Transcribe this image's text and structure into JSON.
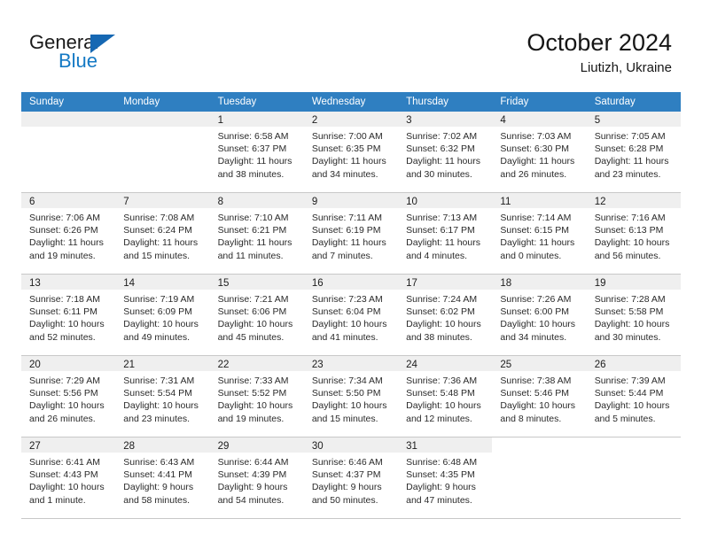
{
  "brand": {
    "name_top": "General",
    "name_bottom": "Blue",
    "triangle_color": "#1668b3",
    "blue_text_color": "#1479c4"
  },
  "header": {
    "title": "October 2024",
    "subtitle": "Liutizh, Ukraine"
  },
  "theme": {
    "header_row_bg": "#2f7fc1",
    "header_row_text": "#ffffff",
    "daynum_bar_bg": "#efefef",
    "grid_line": "#c8c8c8",
    "body_text": "#2a2a2a"
  },
  "labels": {
    "sunrise_prefix": "Sunrise:",
    "sunset_prefix": "Sunset:",
    "daylight_prefix": "Daylight:"
  },
  "weekdays": [
    "Sunday",
    "Monday",
    "Tuesday",
    "Wednesday",
    "Thursday",
    "Friday",
    "Saturday"
  ],
  "weeks": [
    [
      {
        "day": "",
        "empty": true,
        "lines": []
      },
      {
        "day": "",
        "empty": true,
        "lines": []
      },
      {
        "day": "1",
        "lines": [
          "Sunrise: 6:58 AM",
          "Sunset: 6:37 PM",
          "Daylight: 11 hours",
          "and 38 minutes."
        ]
      },
      {
        "day": "2",
        "lines": [
          "Sunrise: 7:00 AM",
          "Sunset: 6:35 PM",
          "Daylight: 11 hours",
          "and 34 minutes."
        ]
      },
      {
        "day": "3",
        "lines": [
          "Sunrise: 7:02 AM",
          "Sunset: 6:32 PM",
          "Daylight: 11 hours",
          "and 30 minutes."
        ]
      },
      {
        "day": "4",
        "lines": [
          "Sunrise: 7:03 AM",
          "Sunset: 6:30 PM",
          "Daylight: 11 hours",
          "and 26 minutes."
        ]
      },
      {
        "day": "5",
        "lines": [
          "Sunrise: 7:05 AM",
          "Sunset: 6:28 PM",
          "Daylight: 11 hours",
          "and 23 minutes."
        ]
      }
    ],
    [
      {
        "day": "6",
        "lines": [
          "Sunrise: 7:06 AM",
          "Sunset: 6:26 PM",
          "Daylight: 11 hours",
          "and 19 minutes."
        ]
      },
      {
        "day": "7",
        "lines": [
          "Sunrise: 7:08 AM",
          "Sunset: 6:24 PM",
          "Daylight: 11 hours",
          "and 15 minutes."
        ]
      },
      {
        "day": "8",
        "lines": [
          "Sunrise: 7:10 AM",
          "Sunset: 6:21 PM",
          "Daylight: 11 hours",
          "and 11 minutes."
        ]
      },
      {
        "day": "9",
        "lines": [
          "Sunrise: 7:11 AM",
          "Sunset: 6:19 PM",
          "Daylight: 11 hours",
          "and 7 minutes."
        ]
      },
      {
        "day": "10",
        "lines": [
          "Sunrise: 7:13 AM",
          "Sunset: 6:17 PM",
          "Daylight: 11 hours",
          "and 4 minutes."
        ]
      },
      {
        "day": "11",
        "lines": [
          "Sunrise: 7:14 AM",
          "Sunset: 6:15 PM",
          "Daylight: 11 hours",
          "and 0 minutes."
        ]
      },
      {
        "day": "12",
        "lines": [
          "Sunrise: 7:16 AM",
          "Sunset: 6:13 PM",
          "Daylight: 10 hours",
          "and 56 minutes."
        ]
      }
    ],
    [
      {
        "day": "13",
        "lines": [
          "Sunrise: 7:18 AM",
          "Sunset: 6:11 PM",
          "Daylight: 10 hours",
          "and 52 minutes."
        ]
      },
      {
        "day": "14",
        "lines": [
          "Sunrise: 7:19 AM",
          "Sunset: 6:09 PM",
          "Daylight: 10 hours",
          "and 49 minutes."
        ]
      },
      {
        "day": "15",
        "lines": [
          "Sunrise: 7:21 AM",
          "Sunset: 6:06 PM",
          "Daylight: 10 hours",
          "and 45 minutes."
        ]
      },
      {
        "day": "16",
        "lines": [
          "Sunrise: 7:23 AM",
          "Sunset: 6:04 PM",
          "Daylight: 10 hours",
          "and 41 minutes."
        ]
      },
      {
        "day": "17",
        "lines": [
          "Sunrise: 7:24 AM",
          "Sunset: 6:02 PM",
          "Daylight: 10 hours",
          "and 38 minutes."
        ]
      },
      {
        "day": "18",
        "lines": [
          "Sunrise: 7:26 AM",
          "Sunset: 6:00 PM",
          "Daylight: 10 hours",
          "and 34 minutes."
        ]
      },
      {
        "day": "19",
        "lines": [
          "Sunrise: 7:28 AM",
          "Sunset: 5:58 PM",
          "Daylight: 10 hours",
          "and 30 minutes."
        ]
      }
    ],
    [
      {
        "day": "20",
        "lines": [
          "Sunrise: 7:29 AM",
          "Sunset: 5:56 PM",
          "Daylight: 10 hours",
          "and 26 minutes."
        ]
      },
      {
        "day": "21",
        "lines": [
          "Sunrise: 7:31 AM",
          "Sunset: 5:54 PM",
          "Daylight: 10 hours",
          "and 23 minutes."
        ]
      },
      {
        "day": "22",
        "lines": [
          "Sunrise: 7:33 AM",
          "Sunset: 5:52 PM",
          "Daylight: 10 hours",
          "and 19 minutes."
        ]
      },
      {
        "day": "23",
        "lines": [
          "Sunrise: 7:34 AM",
          "Sunset: 5:50 PM",
          "Daylight: 10 hours",
          "and 15 minutes."
        ]
      },
      {
        "day": "24",
        "lines": [
          "Sunrise: 7:36 AM",
          "Sunset: 5:48 PM",
          "Daylight: 10 hours",
          "and 12 minutes."
        ]
      },
      {
        "day": "25",
        "lines": [
          "Sunrise: 7:38 AM",
          "Sunset: 5:46 PM",
          "Daylight: 10 hours",
          "and 8 minutes."
        ]
      },
      {
        "day": "26",
        "lines": [
          "Sunrise: 7:39 AM",
          "Sunset: 5:44 PM",
          "Daylight: 10 hours",
          "and 5 minutes."
        ]
      }
    ],
    [
      {
        "day": "27",
        "lines": [
          "Sunrise: 6:41 AM",
          "Sunset: 4:43 PM",
          "Daylight: 10 hours",
          "and 1 minute."
        ]
      },
      {
        "day": "28",
        "lines": [
          "Sunrise: 6:43 AM",
          "Sunset: 4:41 PM",
          "Daylight: 9 hours",
          "and 58 minutes."
        ]
      },
      {
        "day": "29",
        "lines": [
          "Sunrise: 6:44 AM",
          "Sunset: 4:39 PM",
          "Daylight: 9 hours",
          "and 54 minutes."
        ]
      },
      {
        "day": "30",
        "lines": [
          "Sunrise: 6:46 AM",
          "Sunset: 4:37 PM",
          "Daylight: 9 hours",
          "and 50 minutes."
        ]
      },
      {
        "day": "31",
        "lines": [
          "Sunrise: 6:48 AM",
          "Sunset: 4:35 PM",
          "Daylight: 9 hours",
          "and 47 minutes."
        ]
      },
      {
        "day": "",
        "empty": true,
        "blank_white": true,
        "lines": []
      },
      {
        "day": "",
        "empty": true,
        "blank_white": true,
        "lines": []
      }
    ]
  ]
}
